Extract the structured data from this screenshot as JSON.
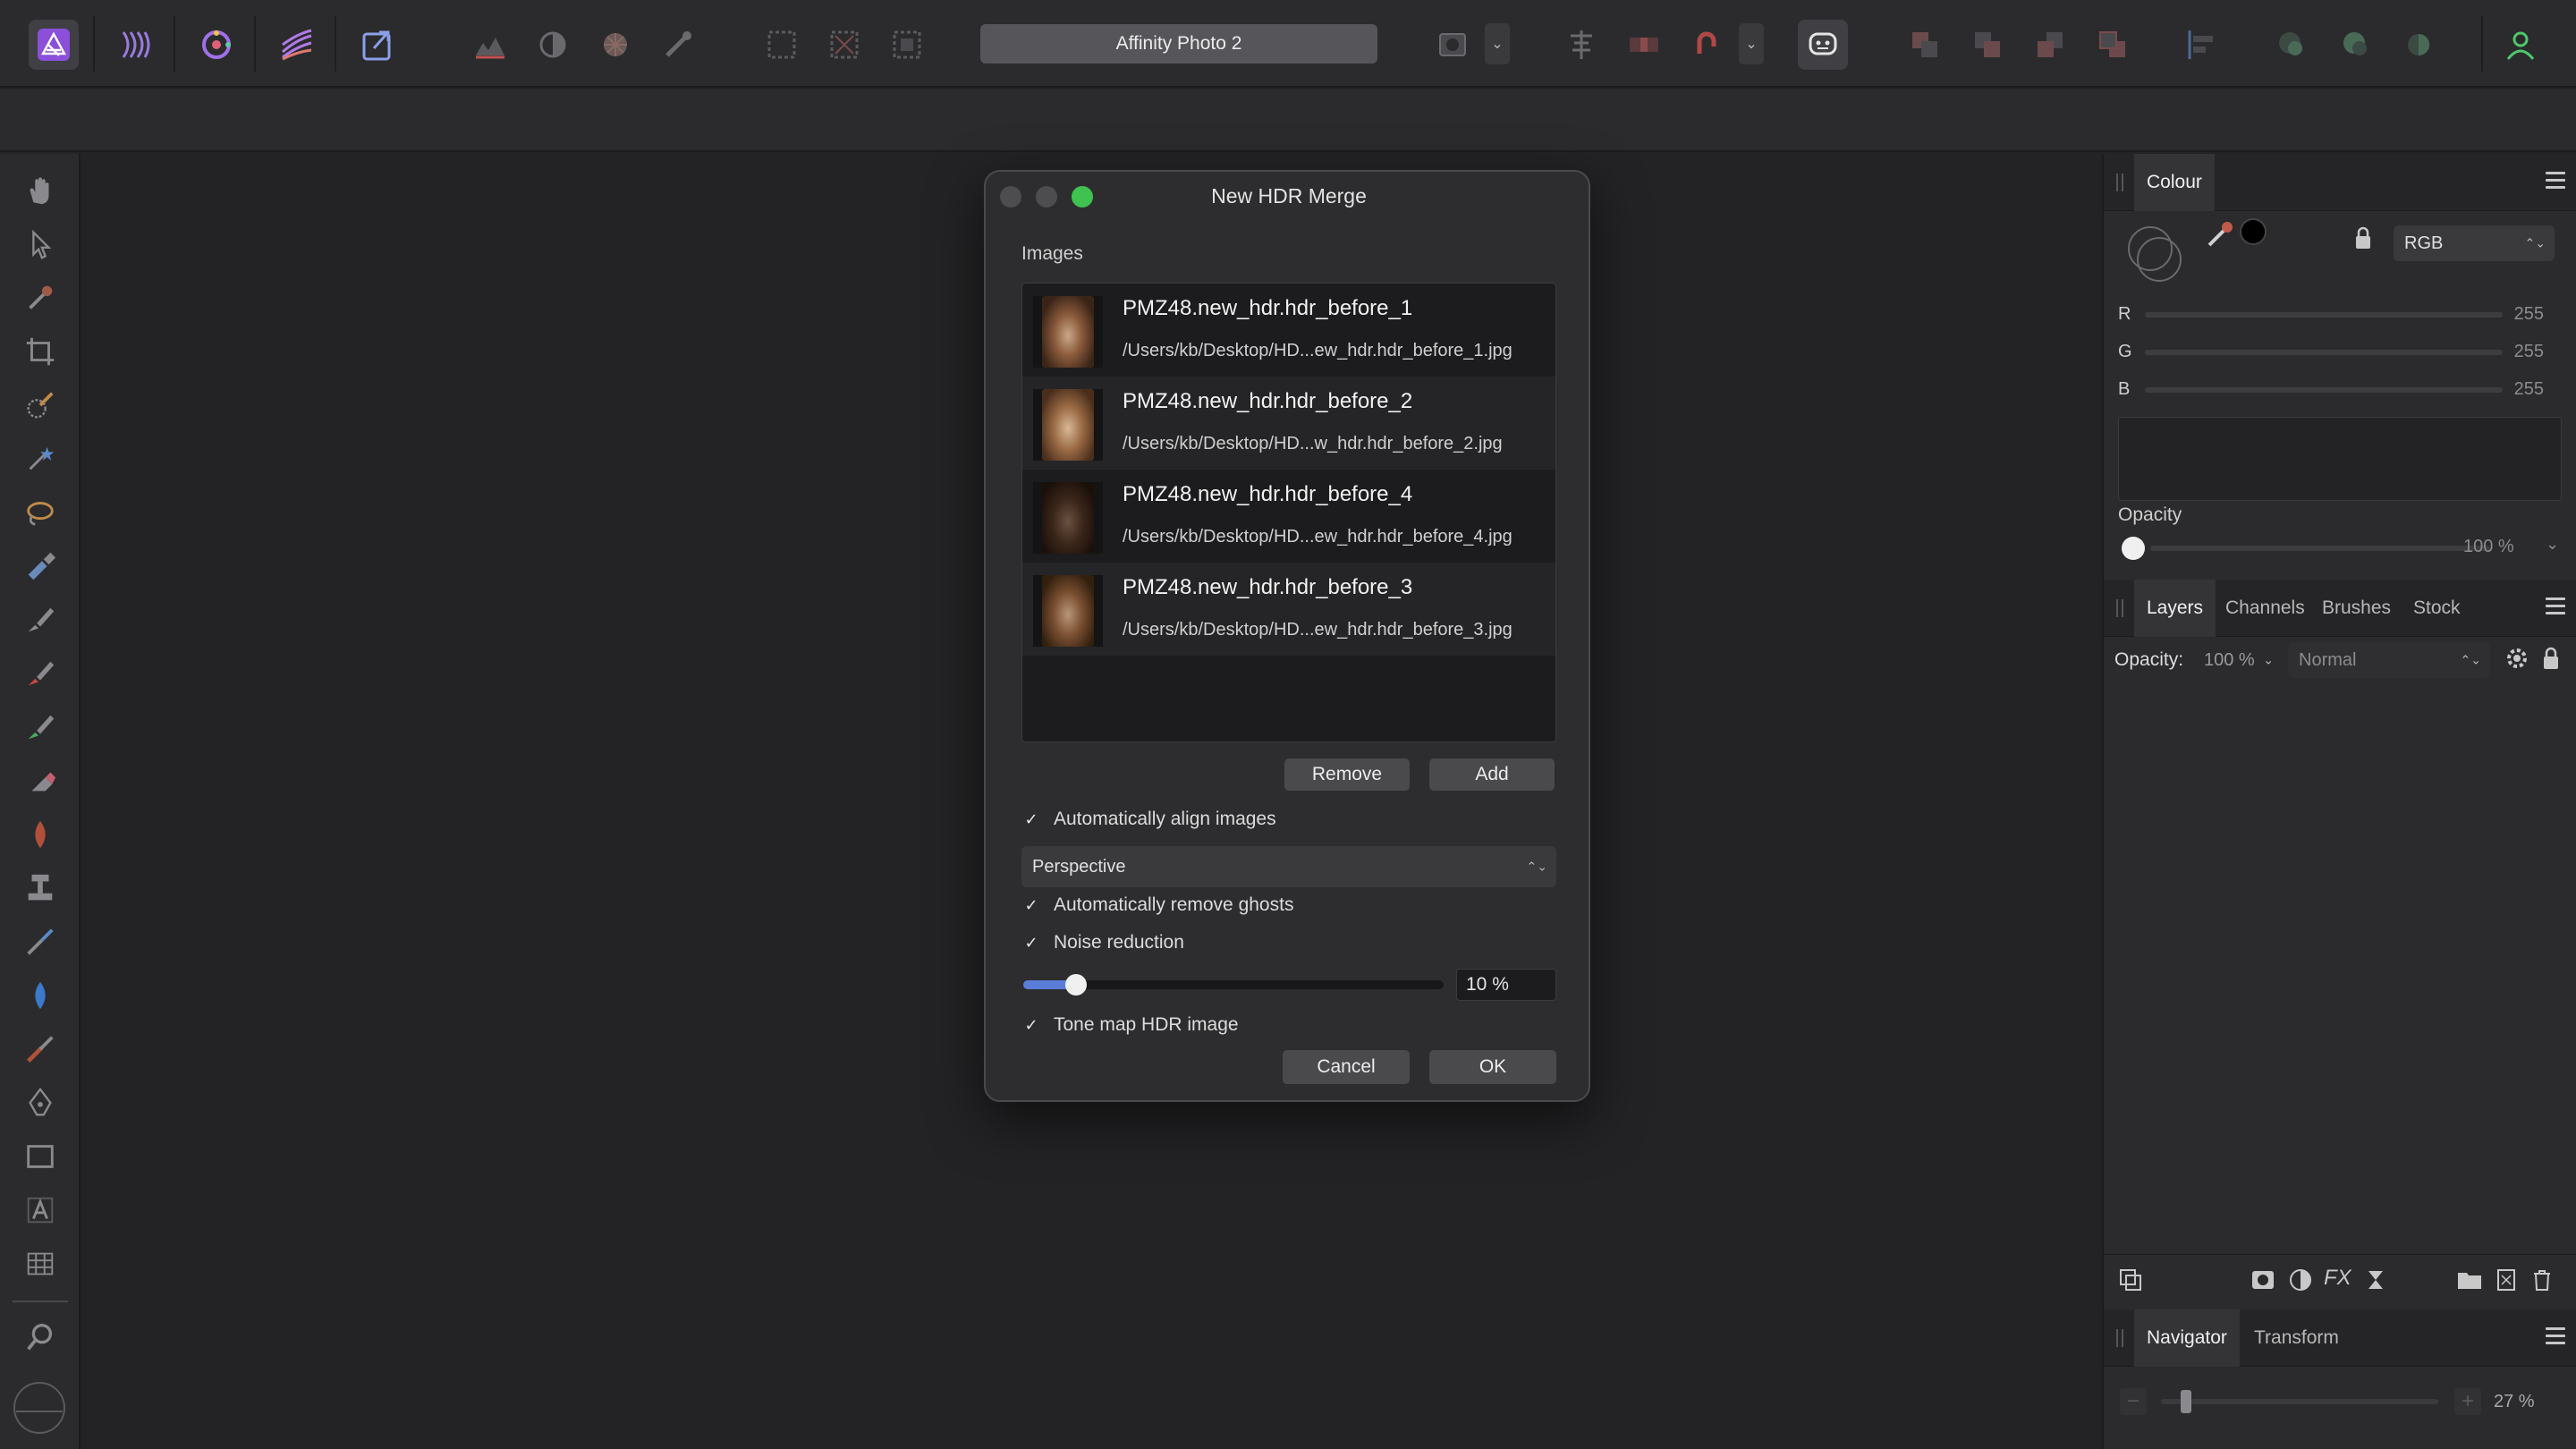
{
  "app": {
    "window_title": "Affinity Photo 2"
  },
  "colors": {
    "accent_blue": "#5a7dd8",
    "traffic_green": "#3fc250",
    "traffic_inactive": "#4d4d50"
  },
  "toolbar": {
    "personas": [
      "photo-persona-icon",
      "liquify-persona-icon",
      "develop-persona-icon",
      "tone-mapping-persona-icon",
      "export-persona-icon"
    ],
    "right_icons": [
      "align-icon",
      "quick-mask-icon",
      "boolean-icon",
      "snapping-icon",
      "assistant-icon",
      "arrange-icon",
      "insert-icon",
      "user-icon"
    ]
  },
  "colour_panel": {
    "tab_label": "Colour",
    "model": "RGB",
    "channels": [
      {
        "label": "R",
        "value": "255"
      },
      {
        "label": "G",
        "value": "255"
      },
      {
        "label": "B",
        "value": "255"
      }
    ],
    "opacity_label": "Opacity",
    "opacity_value": "100 %"
  },
  "layers_panel": {
    "tabs": [
      "Layers",
      "Channels",
      "Brushes",
      "Stock"
    ],
    "opacity_label": "Opacity:",
    "opacity_value": "100 %",
    "blend_mode": "Normal"
  },
  "navigator_panel": {
    "tabs": [
      "Navigator",
      "Transform"
    ],
    "zoom_value": "27 %",
    "zoom_level": 0.27
  },
  "dialog": {
    "title": "New HDR Merge",
    "images_label": "Images",
    "images": [
      {
        "name": "PMZ48.new_hdr.hdr_before_1",
        "path": "/Users/kb/Desktop/HD...ew_hdr.hdr_before_1.jpg"
      },
      {
        "name": "PMZ48.new_hdr.hdr_before_2",
        "path": "/Users/kb/Desktop/HD...w_hdr.hdr_before_2.jpg"
      },
      {
        "name": "PMZ48.new_hdr.hdr_before_4",
        "path": "/Users/kb/Desktop/HD...ew_hdr.hdr_before_4.jpg"
      },
      {
        "name": "PMZ48.new_hdr.hdr_before_3",
        "path": "/Users/kb/Desktop/HD...ew_hdr.hdr_before_3.jpg"
      }
    ],
    "remove_label": "Remove",
    "add_label": "Add",
    "align_label": "Automatically align images",
    "align_checked": true,
    "alignment_mode": "Perspective",
    "ghosts_label": "Automatically remove ghosts",
    "ghosts_checked": true,
    "noise_label": "Noise reduction",
    "noise_checked": true,
    "noise_value_text": "10 %",
    "noise_value": 0.1,
    "tonemap_label": "Tone map HDR image",
    "tonemap_checked": true,
    "cancel_label": "Cancel",
    "ok_label": "OK"
  }
}
